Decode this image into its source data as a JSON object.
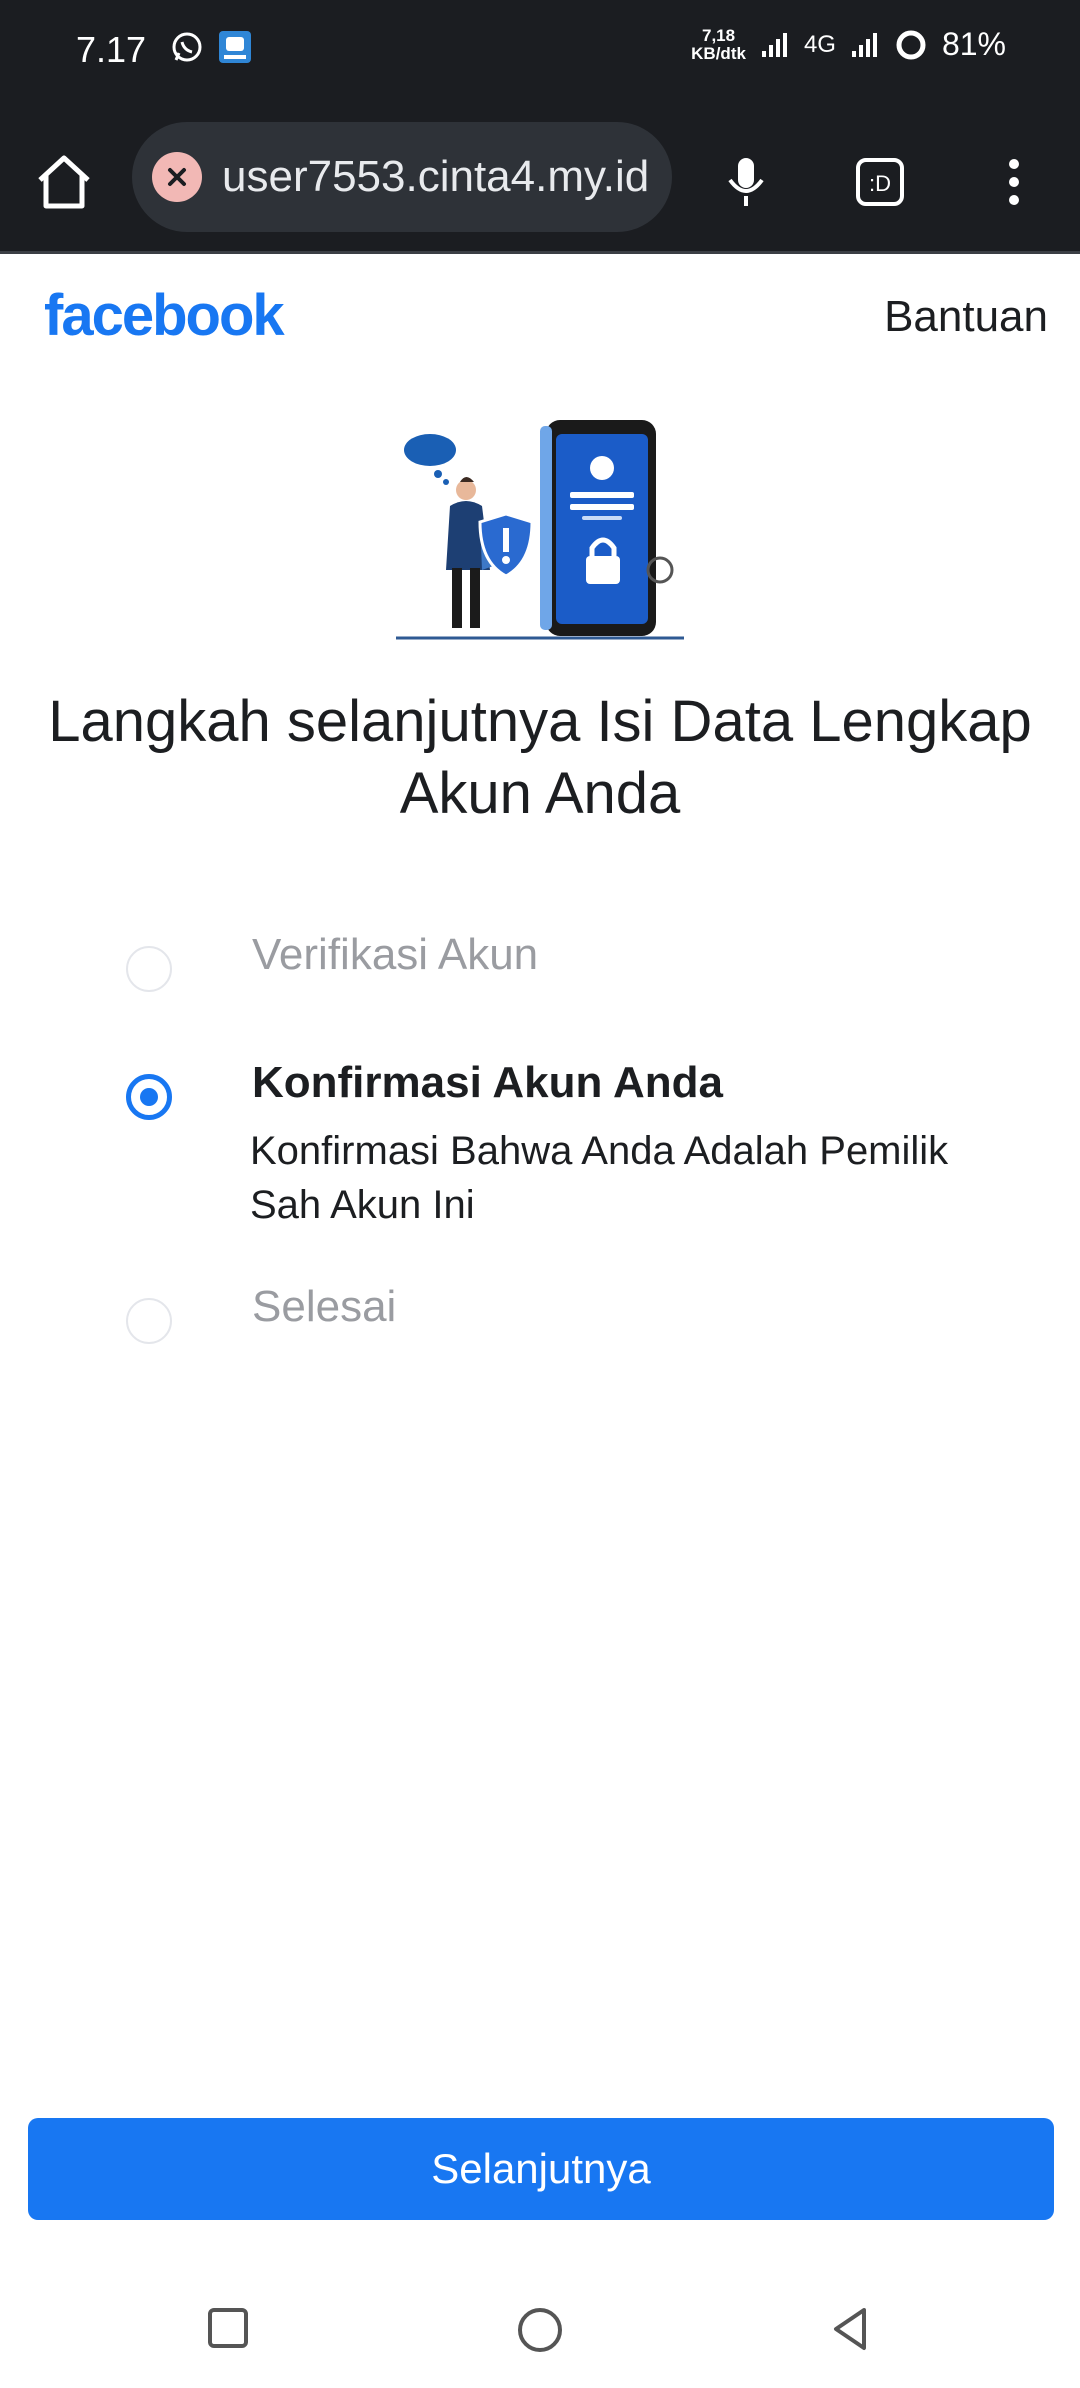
{
  "status_bar": {
    "time": "7.17",
    "net_speed_value": "7,18",
    "net_speed_unit": "KB/dtk",
    "network_type": "4G",
    "battery": "81%"
  },
  "browser": {
    "url": "user7553.cinta4.my.id",
    "tabs_label": ":D"
  },
  "header": {
    "logo": "facebook",
    "help": "Bantuan"
  },
  "heading": "Langkah selanjutnya Isi Data Lengkap Akun Anda",
  "steps": [
    {
      "title": "Verifikasi Akun",
      "active": false
    },
    {
      "title": "Konfirmasi Akun Anda",
      "active": true,
      "description": "Konfirmasi Bahwa Anda Adalah Pemilik Sah Akun Ini"
    },
    {
      "title": "Selesai",
      "active": false
    }
  ],
  "primary_button": "Selanjutnya",
  "colors": {
    "brand": "#1877f2",
    "toolbar": "#1b1d21",
    "inactive_text": "#9a9ca1"
  }
}
